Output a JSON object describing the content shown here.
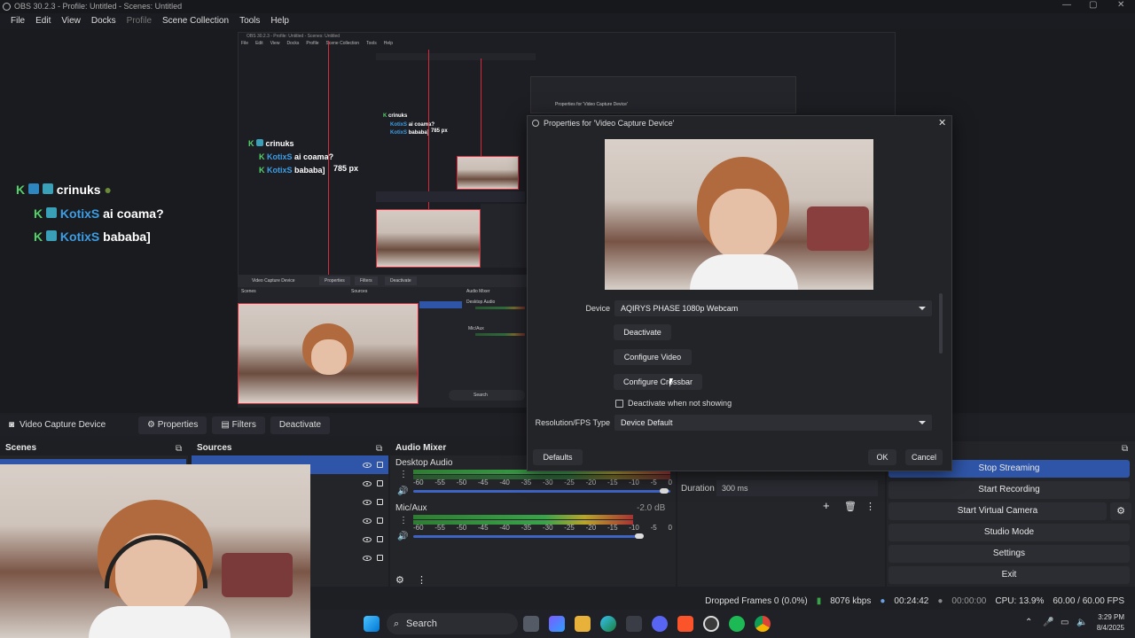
{
  "window": {
    "title": "OBS 30.2.3 - Profile: Untitled - Scenes: Untitled"
  },
  "menu": {
    "items": [
      "File",
      "Edit",
      "View",
      "Docks",
      "Profile",
      "Scene Collection",
      "Tools",
      "Help"
    ]
  },
  "nested": {
    "title": "OBS 30.2.3 - Profile: Untitled - Scenes: Untitled",
    "menu": [
      "File",
      "Edit",
      "View",
      "Docks",
      "Profile",
      "Scene Collection",
      "Tools",
      "Help"
    ],
    "dock_source": "Video Capture Device",
    "dock_buttons": [
      "Properties",
      "Filters",
      "Deactivate"
    ],
    "panels": [
      "Scenes",
      "Sources",
      "Audio Mixer"
    ],
    "mixer_channels": [
      "Desktop Audio",
      "Mic/Aux"
    ],
    "search": "Search",
    "dialog_title": "Properties for 'Video Capture Device'"
  },
  "chat": {
    "line1_user": "crinuks",
    "line2_user": "KotixS",
    "line2_msg": "ai coama?",
    "line3_user": "KotixS",
    "line3_msg": "bababa]",
    "measure": "785 px"
  },
  "context_bar": {
    "source": "Video Capture Device",
    "properties": "Properties",
    "filters": "Filters",
    "deactivate": "Deactivate"
  },
  "docks": {
    "scenes": "Scenes",
    "sources": "Sources",
    "mixer": "Audio Mixer"
  },
  "mixer": {
    "channels": [
      {
        "name": "Desktop Audio",
        "db": ""
      },
      {
        "name": "Mic/Aux",
        "db": "-2.0 dB"
      }
    ],
    "scale": [
      "-60",
      "-55",
      "-50",
      "-45",
      "-40",
      "-35",
      "-30",
      "-25",
      "-20",
      "-15",
      "-10",
      "-5",
      "0"
    ]
  },
  "transitions": {
    "duration_label": "Duration",
    "duration_value": "300 ms"
  },
  "controls": {
    "stop_streaming": "Stop Streaming",
    "start_recording": "Start Recording",
    "start_virtual_camera": "Start Virtual Camera",
    "studio_mode": "Studio Mode",
    "settings": "Settings",
    "exit": "Exit"
  },
  "status": {
    "dropped_frames": "Dropped Frames 0 (0.0%)",
    "bitrate": "8076 kbps",
    "stream_time": "00:24:42",
    "record_time": "00:00:00",
    "cpu": "CPU: 13.9%",
    "fps": "60.00 / 60.00 FPS"
  },
  "dialog": {
    "title": "Properties for 'Video Capture Device'",
    "device_label": "Device",
    "device_value": "AQIRYS PHASE 1080p Webcam",
    "deactivate": "Deactivate",
    "configure_video": "Configure Video",
    "configure_crossbar": "Configure Crossbar",
    "deactivate_when_not_showing": "Deactivate when not showing",
    "resolution_label": "Resolution/FPS Type",
    "resolution_value": "Device Default",
    "defaults": "Defaults",
    "ok": "OK",
    "cancel": "Cancel"
  },
  "taskbar": {
    "search": "Search",
    "time": "3:29 PM",
    "date": "8/4/2025"
  },
  "colors": {
    "accent": "#2f55a8",
    "selection_red": "#d52b3a",
    "meter_green": "#3aa34a"
  }
}
